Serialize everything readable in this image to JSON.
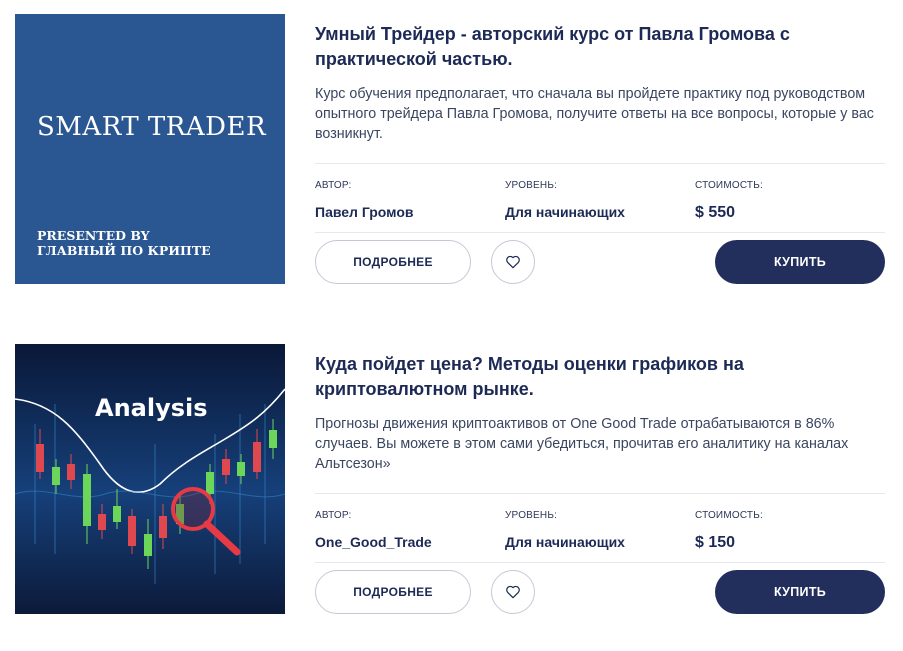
{
  "courses": [
    {
      "image": {
        "title": "SMART TRADER",
        "subtitle_line1": "PRESENTED BY",
        "subtitle_line2": "ГЛАВНЫЙ ПО КРИПТЕ",
        "background": "#2a5691"
      },
      "title": "Умный Трейдер - авторский курс от Павла Громова с практической частью.",
      "description": "Курс обучения предполагает, что сначала вы пройдете практику под руководством опытного трейдера Павла Громова, получите ответы на все вопросы, которые у вас возникнут.",
      "author_label": "АВТОР:",
      "author": "Павел Громов",
      "level_label": "УРОВЕНЬ:",
      "level": "Для начинающих",
      "price_label": "СТОИМОСТЬ:",
      "price": "$ 550",
      "more_label": "ПОДРОБНЕЕ",
      "fav_icon": "heart-icon",
      "buy_label": "КУПИТЬ"
    },
    {
      "image": {
        "title": "Analysis",
        "background": "#0d1f45"
      },
      "title": "Куда пойдет цена? Методы оценки графиков на криптовалютном рынке.",
      "description": "Прогнозы движения криптоактивов от  One Good Trade отрабатываются в 86% случаев. Вы можете в этом сами убедиться, прочитав его аналитику на каналах Альтсезон»",
      "author_label": "АВТОР:",
      "author": "One_Good_Trade",
      "level_label": "УРОВЕНЬ:",
      "level": "Для начинающих",
      "price_label": "СТОИМОСТЬ:",
      "price": "$ 150",
      "more_label": "ПОДРОБНЕЕ",
      "fav_icon": "heart-icon",
      "buy_label": "КУПИТЬ"
    }
  ],
  "colors": {
    "primary": "#222e5b",
    "text": "#1c2a55",
    "border": "#c5c9d4"
  }
}
